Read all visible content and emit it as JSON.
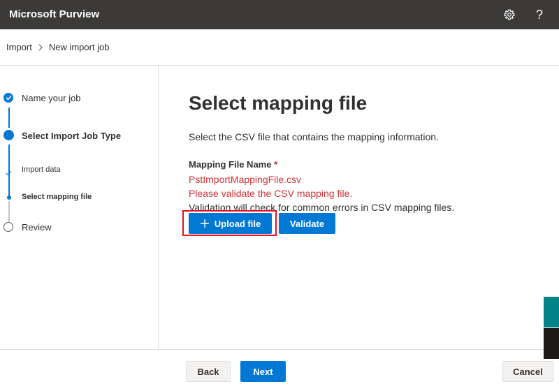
{
  "header": {
    "app_title": "Microsoft Purview",
    "settings_icon": "gear-icon",
    "help_label": "?"
  },
  "breadcrumb": {
    "items": [
      "Import",
      "New import job"
    ]
  },
  "steps": {
    "items": [
      {
        "label": "Name your job",
        "state": "completed"
      },
      {
        "label": "Select Import Job Type",
        "state": "active"
      },
      {
        "label": "Import data",
        "state": "sub-completed"
      },
      {
        "label": "Select mapping file",
        "state": "sub-active"
      },
      {
        "label": "Review",
        "state": "pending"
      }
    ]
  },
  "main": {
    "title": "Select mapping file",
    "description": "Select the CSV file that contains the mapping information.",
    "field_label": "Mapping File Name",
    "required_mark": "*",
    "file_name": "PstImportMappingFile.csv",
    "validation_warning": "Please validate the CSV mapping file.",
    "validation_note": "Validation will check for common errors in CSV mapping files.",
    "upload_button": "Upload file",
    "validate_button": "Validate"
  },
  "footer": {
    "back_button": "Back",
    "next_button": "Next",
    "cancel_button": "Cancel"
  },
  "colors": {
    "accent": "#0078d4",
    "error": "#d13438",
    "header_bg": "#3b3a39",
    "highlight": "#e81123"
  }
}
